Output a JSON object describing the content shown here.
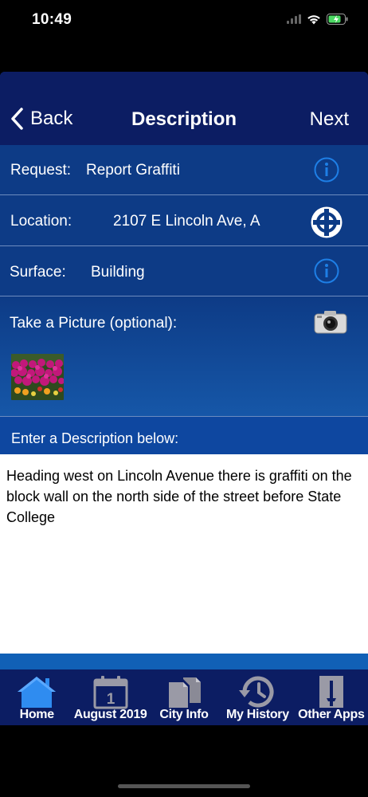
{
  "status_bar": {
    "time": "10:49",
    "icons": [
      "signal-icon",
      "wifi-icon",
      "battery-charging-icon"
    ]
  },
  "nav": {
    "back_label": "Back",
    "title": "Description",
    "next_label": "Next"
  },
  "rows": {
    "request": {
      "label": "Request:",
      "value": "Report Graffiti",
      "icon": "info-icon"
    },
    "location": {
      "label": "Location:",
      "value": "2107 E Lincoln Ave, A",
      "icon": "location-crosshair-icon"
    },
    "surface": {
      "label": "Surface:",
      "value": "Building",
      "icon": "info-icon"
    },
    "picture": {
      "label": "Take a Picture (optional):",
      "icon": "camera-icon",
      "thumbnail": "flowers-photo"
    }
  },
  "description": {
    "header": "Enter a Description below:",
    "text": "Heading west on Lincoln Avenue there is graffiti on the block wall on the north side of the street before State College"
  },
  "tabs": [
    {
      "label": "Home",
      "icon": "home-icon",
      "active": true
    },
    {
      "label": "August 2019",
      "icon": "calendar-icon",
      "calendar_day": "1"
    },
    {
      "label": "City Info",
      "icon": "documents-icon"
    },
    {
      "label": "My History",
      "icon": "history-icon"
    },
    {
      "label": "Other Apps",
      "icon": "other-apps-icon"
    }
  ],
  "colors": {
    "nav_bar": "#0c1d63",
    "row_bg": "#0d3b86",
    "accent_blue": "#1e7fe6",
    "active_tab": "#2f8cf0"
  }
}
